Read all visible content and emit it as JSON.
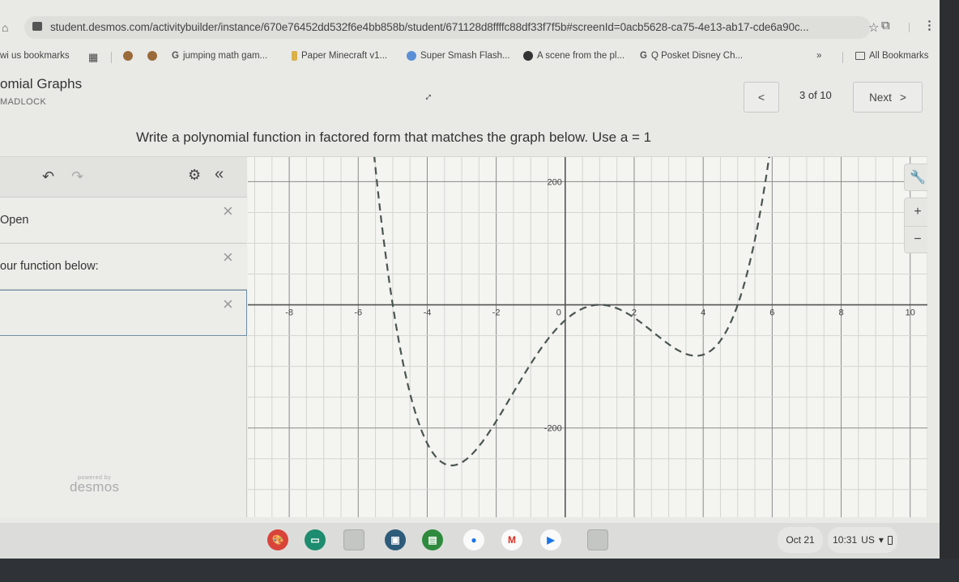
{
  "browser": {
    "url": "student.desmos.com/activitybuilder/instance/670e76452dd532f6e4bb858b/student/671128d8ffffc88df33f7f5b#screenId=0acb5628-ca75-4e13-ab17-cde6a90c...",
    "bookmarks": [
      {
        "label": "wi us bookmarks",
        "icon": "none"
      },
      {
        "label": "",
        "icon": "apps-grid-icon"
      },
      {
        "label": "",
        "icon": "avatar-icon"
      },
      {
        "label": "",
        "icon": "avatar-icon"
      },
      {
        "label": "jumping math gam...",
        "icon": "google-icon"
      },
      {
        "label": "Paper Minecraft v1...",
        "icon": "bookmark-favicon"
      },
      {
        "label": "Super Smash Flash...",
        "icon": "shield-favicon"
      },
      {
        "label": "A scene from the pl...",
        "icon": "globe-icon"
      },
      {
        "label": "Q Posket Disney Ch...",
        "icon": "google-icon"
      }
    ],
    "overflow_label": "»",
    "all_bookmarks_label": "All Bookmarks"
  },
  "activity": {
    "title": "omial Graphs",
    "student": "MADLOCK",
    "page_indicator": "3 of 10",
    "prev_label": "<",
    "next_label": "Next",
    "next_chevron": ">",
    "prompt": "Write a polynomial function in factored form that matches the graph below. Use a = 1"
  },
  "desmos": {
    "expressions": [
      {
        "text": "Open",
        "delete": "×"
      },
      {
        "text": "our function below:",
        "delete": "×"
      },
      {
        "text": "",
        "delete": "×"
      }
    ],
    "powered_by": "powered by",
    "brand": "desmos",
    "tools": {
      "wrench": "🔧",
      "zoom_in": "+",
      "zoom_out": "−"
    }
  },
  "chart_data": {
    "type": "line",
    "title": "",
    "xlabel": "",
    "ylabel": "",
    "xlim": [
      -9.2,
      10.5
    ],
    "ylim": [
      -345,
      240
    ],
    "x_ticks": [
      -8,
      -6,
      -4,
      -2,
      0,
      2,
      4,
      6,
      8,
      10
    ],
    "y_ticks": [
      200,
      -200
    ],
    "x_minor_step": 0.5,
    "y_minor_step": 50,
    "grid": true,
    "series": [
      {
        "name": "f(x) = (x+5)(x-1)^2(x-5)",
        "style": "dashed",
        "color": "#4a5550",
        "roots": [
          -5,
          1,
          1,
          5
        ],
        "leading_coefficient": 1,
        "sample_points": [
          {
            "x": -5.6,
            "y": 311
          },
          {
            "x": -5,
            "y": 0
          },
          {
            "x": -4,
            "y": -225
          },
          {
            "x": -3.5,
            "y": -258
          },
          {
            "x": -3,
            "y": -256
          },
          {
            "x": -2,
            "y": -189
          },
          {
            "x": -1,
            "y": -96
          },
          {
            "x": 0,
            "y": -25
          },
          {
            "x": 1,
            "y": 0
          },
          {
            "x": 2,
            "y": -21
          },
          {
            "x": 3,
            "y": -64
          },
          {
            "x": 3.8,
            "y": -83
          },
          {
            "x": 4,
            "y": -81
          },
          {
            "x": 5,
            "y": 0
          },
          {
            "x": 5.9,
            "y": 227
          }
        ]
      }
    ]
  },
  "shelf": {
    "apps": [
      {
        "name": "canvas-app-icon",
        "color": "#d9443a",
        "glyph": "🎨"
      },
      {
        "name": "classroom-screen-icon",
        "color": "#1e8c6e",
        "glyph": "▭"
      },
      {
        "name": "blank-app-icon",
        "color": "#c4c6c4",
        "glyph": ""
      },
      {
        "name": "student-app-icon",
        "color": "#2d5b7a",
        "glyph": "▣"
      },
      {
        "name": "google-classroom-icon",
        "color": "#2e8b3d",
        "glyph": "▤"
      },
      {
        "name": "chrome-icon",
        "color": "#1a73e8",
        "glyph": "●"
      },
      {
        "name": "gmail-icon",
        "color": "#d93025",
        "glyph": "M"
      },
      {
        "name": "play-store-icon",
        "color": "#1a73e8",
        "glyph": "▶"
      },
      {
        "name": "blank-app-icon-2",
        "color": "#c4c6c4",
        "glyph": ""
      }
    ],
    "date": "Oct 21",
    "time": "10:31",
    "locale": "US"
  }
}
